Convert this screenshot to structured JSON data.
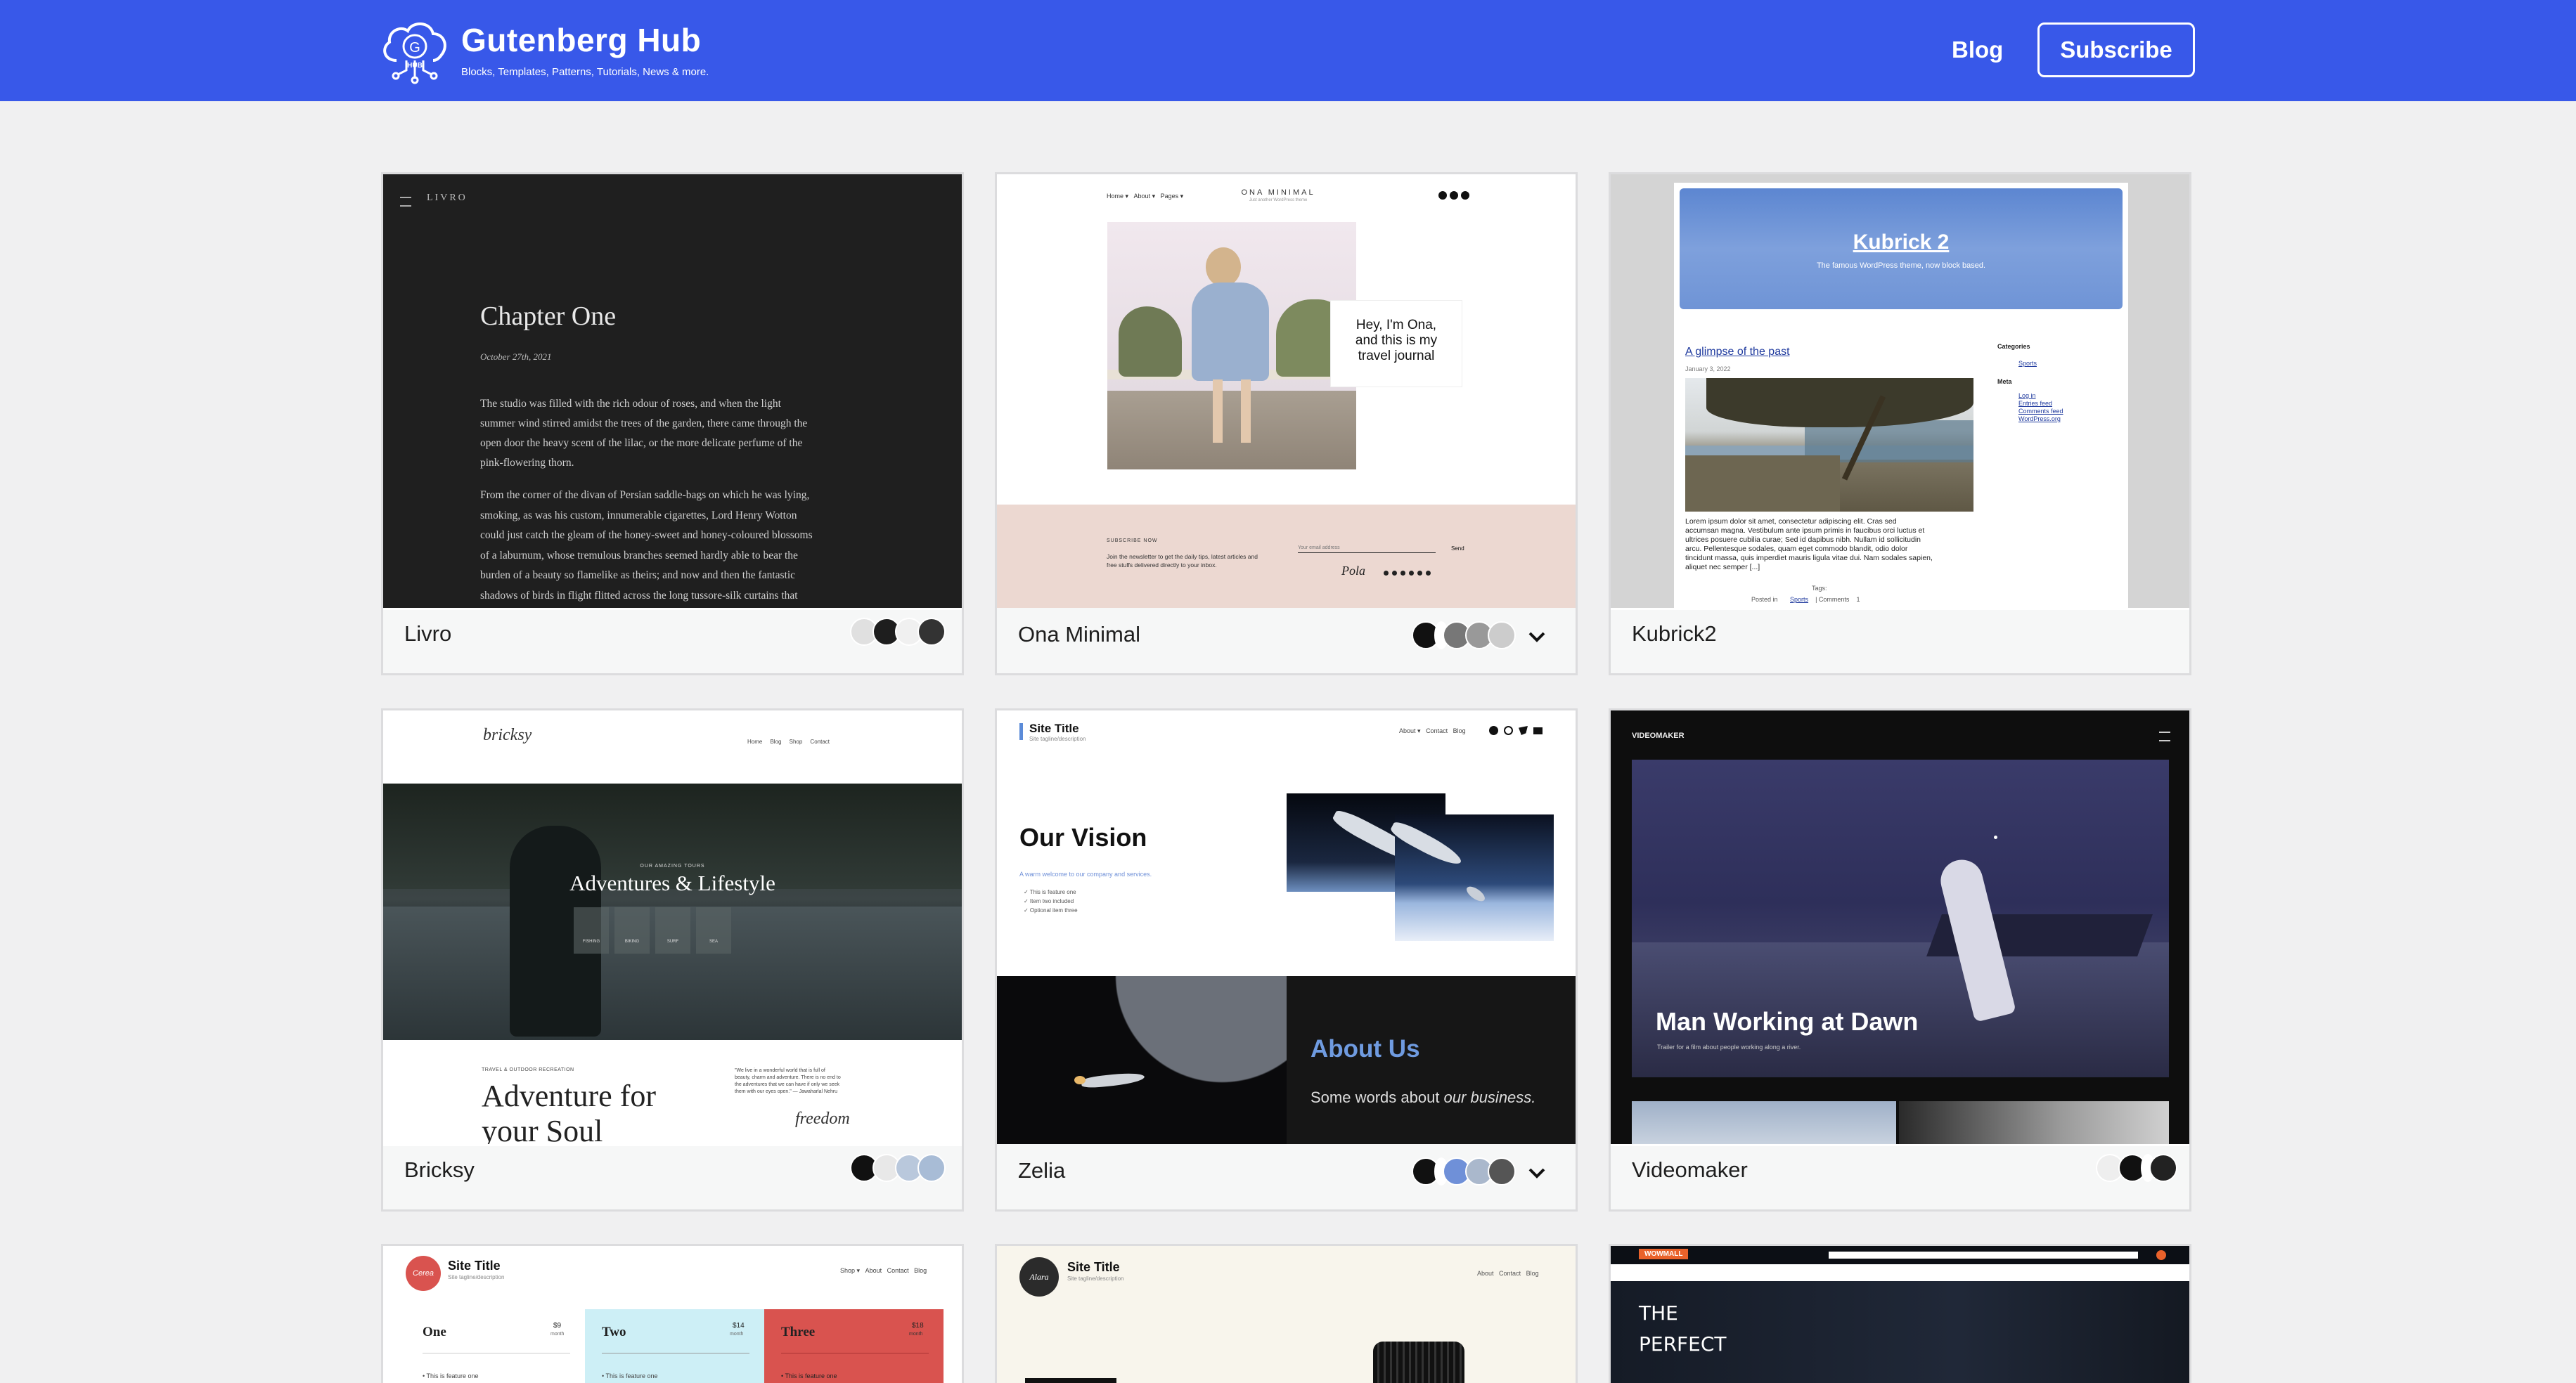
{
  "header": {
    "logo_letter": "G",
    "logo_sub": "HUB",
    "title": "Gutenberg Hub",
    "tagline": "Blocks, Templates, Patterns, Tutorials, News & more.",
    "nav_blog": "Blog",
    "nav_subscribe": "Subscribe",
    "bg_color": "#3858e9"
  },
  "cards": [
    {
      "name": "Livro",
      "swatches": [
        "#e0e0e0",
        "#1e1e1e",
        "#f0f0f0",
        "#333333"
      ],
      "has_chevron": false
    },
    {
      "name": "Ona Minimal",
      "swatches": [
        "#111111",
        "#777777",
        "#999999",
        "#cccccc"
      ],
      "has_chevron": true
    },
    {
      "name": "Kubrick2",
      "swatches": [],
      "has_chevron": false
    },
    {
      "name": "Bricksy",
      "swatches": [
        "#111111",
        "#e0e0e0",
        "#b9c8dc",
        "#a8bcd6"
      ],
      "has_chevron": false
    },
    {
      "name": "Zelia",
      "swatches": [
        "#111111",
        "#6f90d8",
        "#aab8cc",
        "#555555"
      ],
      "has_chevron": true
    },
    {
      "name": "Videomaker",
      "swatches": [
        "#eeeeee",
        "#111111",
        "#ffffff",
        "#222222"
      ],
      "has_chevron": false
    }
  ],
  "livro": {
    "menu_label": "LIVRO",
    "heading": "Chapter One",
    "date": "October 27th, 2021",
    "p1": [
      "The studio was filled with the rich odour of roses, and when the light",
      "summer wind stirred amidst the trees of the garden, there came through the",
      "open door the heavy scent of the lilac, or the more delicate perfume of the",
      "pink-flowering thorn."
    ],
    "p2": [
      "From the corner of the divan of Persian saddle-bags on which he was lying,",
      "smoking, as was his custom, innumerable cigarettes, Lord Henry Wotton",
      "could just catch the gleam of the honey-sweet and honey-coloured blossoms",
      "of a laburnum, whose tremulous branches seemed hardly able to bear the",
      "burden of a beauty so flamelike as theirs; and now and then the fantastic",
      "shadows of birds in flight flitted across the long tussore-silk curtains that"
    ]
  },
  "ona": {
    "nav": [
      "Home ▾",
      "About ▾",
      "Pages ▾"
    ],
    "logo": "ONA MINIMAL",
    "logo_sub": "Just another WordPress theme",
    "bubble": [
      "Hey, I'm Ona,",
      "and this is my",
      "travel journal"
    ],
    "sub_label": "SUBSCRIBE NOW",
    "sub_text": [
      "Join the newsletter to get the daily tips, latest articles and",
      "free stuffs delivered directly to your inbox."
    ],
    "email_ph": "Your email address",
    "btn": "Send",
    "signature": "Pola"
  },
  "kubrick": {
    "title": "Kubrick 2",
    "subtitle": "The famous WordPress theme, now block based.",
    "post_title": "A glimpse of the past",
    "post_date": "January 3, 2022",
    "excerpt": [
      "Lorem ipsum dolor sit amet, consectetur adipiscing elit. Cras sed",
      "accumsan magna. Vestibulum ante ipsum primis in faucibus orci luctus et",
      "ultrices posuere cubilia curae; Sed id dapibus nibh. Nullam id sollicitudin",
      "arcu. Pellentesque sodales, quam eget commodo blandit, odio dolor",
      "tincidunt massa, quis imperdiet mauris ligula vitae dui. Nam sodales sapien,",
      "aliquet nec semper [...]"
    ],
    "tags_label": "Tags:",
    "posted_in": "Posted in",
    "category": "Sports",
    "comments": "| Comments",
    "comments_count": "1",
    "cat_heading": "Categories",
    "cat_items": [
      "Sports"
    ],
    "meta_heading": "Meta",
    "meta_items": [
      "Log in",
      "Entries feed",
      "Comments feed",
      "WordPress.org"
    ]
  },
  "bricksy": {
    "logo": "bricksy",
    "nav": [
      "Home",
      "Blog",
      "Shop",
      "Contact"
    ],
    "kicker": "OUR AMAZING TOURS",
    "hero": "Adventures & Lifestyle",
    "icons": [
      "FISHING",
      "BIKING",
      "SURF",
      "SEA"
    ],
    "small_label": "TRAVEL & OUTDOOR RECREATION",
    "big": [
      "Adventure for",
      "your Soul"
    ],
    "quote": [
      "\"We live in a wonderful world that is full of",
      "beauty, charm and adventure. There is no end to",
      "the adventures that we can have if only we seek",
      "them with our eyes open.\" — Jawaharlal Nehru"
    ],
    "signature": "freedom"
  },
  "zelia": {
    "site_title": "Site Title",
    "tagline": "Site tagline/description",
    "nav": [
      "About ▾",
      "Contact",
      "Blog"
    ],
    "vision": "Our Vision",
    "vision_sub": "A warm welcome to our company and services.",
    "features": [
      "✓ This is feature one",
      "✓ Item two included",
      "✓ Optional item three"
    ],
    "about": "About Us",
    "about_sub_a": "Some words about ",
    "about_sub_b": "our business."
  },
  "video": {
    "brand": "VIDEOMAKER",
    "title": "Man Working at Dawn",
    "sub": "Trailer for a film about people working along a river."
  },
  "row3": {
    "cerea_logo": "Cerea",
    "cerea_title": "Site Title",
    "cerea_tag": "Site tagline/description",
    "cerea_nav": [
      "Shop ▾",
      "About",
      "Contact",
      "Blog"
    ],
    "tiers": [
      {
        "name": "One",
        "price": "$9",
        "unit": "month",
        "feature": "• This is feature one"
      },
      {
        "name": "Two",
        "price": "$14",
        "unit": "month",
        "feature": "• This is feature one"
      },
      {
        "name": "Three",
        "price": "$18",
        "unit": "month",
        "feature": "• This is feature one"
      }
    ],
    "alara_logo": "Alara",
    "alara_title": "Site Title",
    "alara_tag": "Site tagline/description",
    "alara_nav": [
      "About",
      "Contact",
      "Blog"
    ],
    "wow_brand": "WOWMALL",
    "wow_text": [
      "THE",
      "PERFECT"
    ]
  }
}
